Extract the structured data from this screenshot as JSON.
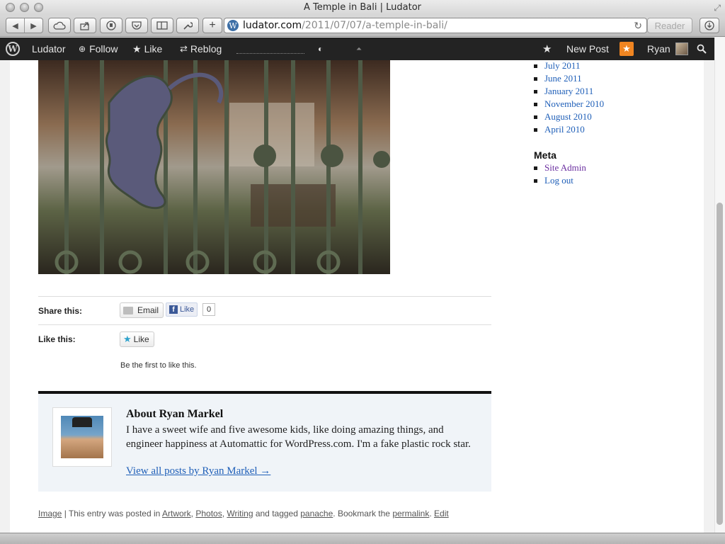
{
  "window": {
    "title": "A Temple in Bali | Ludator"
  },
  "toolbar": {
    "url_host": "ludator.com",
    "url_path": "/2011/07/07/a-temple-in-bali/",
    "reader_label": "Reader",
    "reload_glyph": "↻",
    "favicon_glyph": "W"
  },
  "adminbar": {
    "site_name": "Ludator",
    "follow_label": "Follow",
    "like_label": "Like",
    "reblog_label": "Reblog",
    "new_post_label": "New Post",
    "user_name": "Ryan",
    "wp_glyph": "W"
  },
  "share": {
    "share_label": "Share this:",
    "email_label": "Email",
    "fb_like_label": "Like",
    "fb_count": "0",
    "like_this_label": "Like this:",
    "like_button_label": "Like",
    "first_to_like": "Be the first to like this."
  },
  "author": {
    "title": "About Ryan Markel",
    "bio": "I have a sweet wife and five awesome kids, like doing amazing things, and engineer happiness at Automattic for WordPress.com. I'm a fake plastic rock star.",
    "link": "View all posts by Ryan Markel →"
  },
  "footer_meta": {
    "image_label": "Image",
    "sep1": " | This entry was posted in ",
    "cat1": "Artwork",
    "comma1": ", ",
    "cat2": "Photos",
    "comma2": ", ",
    "cat3": "Writing",
    "tagged": " and tagged ",
    "tag1": "panache",
    "bookmark": ". Bookmark the ",
    "permalink": "permalink",
    "dot": ". ",
    "edit": "Edit"
  },
  "sidebar": {
    "archives": [
      {
        "label": "July 2011"
      },
      {
        "label": "June 2011"
      },
      {
        "label": "January 2011"
      },
      {
        "label": "November 2010"
      },
      {
        "label": "August 2010"
      },
      {
        "label": "April 2010"
      }
    ],
    "meta_heading": "Meta",
    "meta_items": [
      {
        "label": "Site Admin"
      },
      {
        "label": "Log out"
      }
    ]
  },
  "colors": {
    "adminbar_bg": "#232323",
    "link_blue": "#1f5fb8",
    "visited_purple": "#6b2fa0",
    "notification_orange": "#f08521",
    "author_box_bg": "#f0f4f8"
  },
  "icons": [
    "wordpress-logo-icon",
    "follow-plus-icon",
    "like-star-icon",
    "reblog-icon",
    "notifications-star-icon",
    "search-icon",
    "email-icon",
    "facebook-icon"
  ]
}
